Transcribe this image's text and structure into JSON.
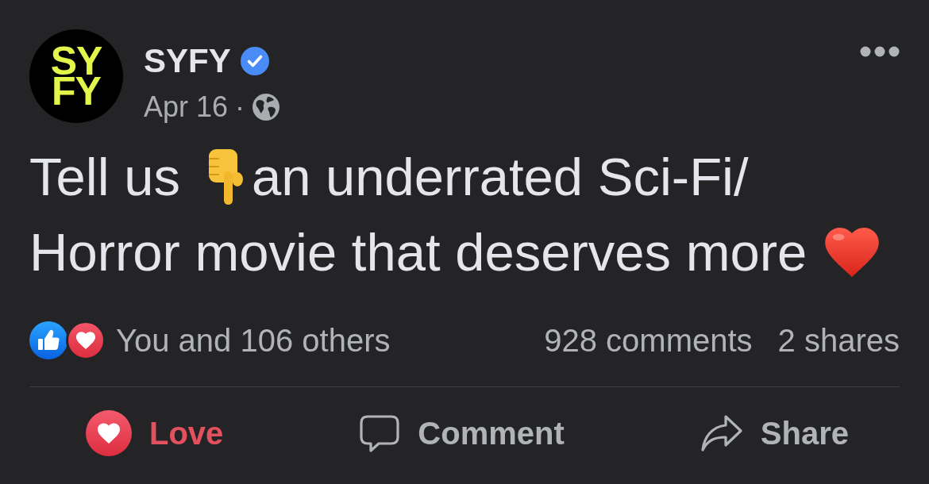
{
  "post": {
    "author": {
      "logo_lines": [
        "SY",
        "FY"
      ],
      "name": "SYFY",
      "verified": true
    },
    "date": "Apr 16",
    "separator": "·",
    "message": [
      "Tell us",
      "an underrated Sci-Fi/",
      "Horror movie that deserves more"
    ]
  },
  "reactions": {
    "summary": "You and 106 others",
    "comments": "928 comments",
    "shares": "2 shares"
  },
  "actions": [
    {
      "kind": "react",
      "label": "Love",
      "selected": true
    },
    {
      "kind": "comment",
      "label": "Comment",
      "selected": false
    },
    {
      "kind": "share",
      "label": "Share",
      "selected": false
    }
  ]
}
